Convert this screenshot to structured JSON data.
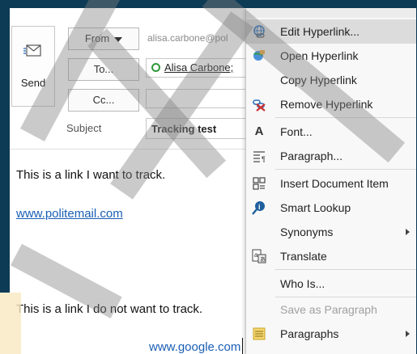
{
  "compose": {
    "send_label": "Send",
    "from_label": "From",
    "from_value": "alisa.carbone@pol",
    "to_label": "To...",
    "to_recipient": "Alisa Carbone;",
    "cc_label": "Cc...",
    "subject_label": "Subject",
    "subject_value": "Tracking test"
  },
  "body": {
    "line1": "This is a link I want to track.",
    "link1": "www.politemail.com",
    "line2": "This is a link I do not want to track.",
    "link2": "www.google.com"
  },
  "context_menu": {
    "items": [
      {
        "label": "Edit Hyperlink...",
        "icon": "link-edit-icon",
        "highlight": true
      },
      {
        "label": "Open Hyperlink",
        "icon": "globe-open-icon"
      },
      {
        "label": "Copy Hyperlink",
        "icon": ""
      },
      {
        "label": "Remove Hyperlink",
        "icon": "link-remove-icon"
      },
      {
        "label": "Font...",
        "icon": "font-icon"
      },
      {
        "label": "Paragraph...",
        "icon": "paragraph-icon"
      },
      {
        "label": "Insert Document Item",
        "icon": "document-item-icon"
      },
      {
        "label": "Smart Lookup",
        "icon": "smart-lookup-icon"
      },
      {
        "label": "Synonyms",
        "icon": "",
        "submenu": true
      },
      {
        "label": "Translate",
        "icon": "translate-icon"
      },
      {
        "label": "Who Is...",
        "icon": ""
      },
      {
        "label": "Save as Paragraph",
        "icon": "",
        "disabled": true
      },
      {
        "label": "Paragraphs",
        "icon": "paragraphs-icon",
        "submenu": true
      }
    ]
  },
  "colors": {
    "frame": "#0d3a55",
    "link": "#1a5fb4",
    "highlight": "#dcdcdc",
    "watermark": "#808080"
  }
}
